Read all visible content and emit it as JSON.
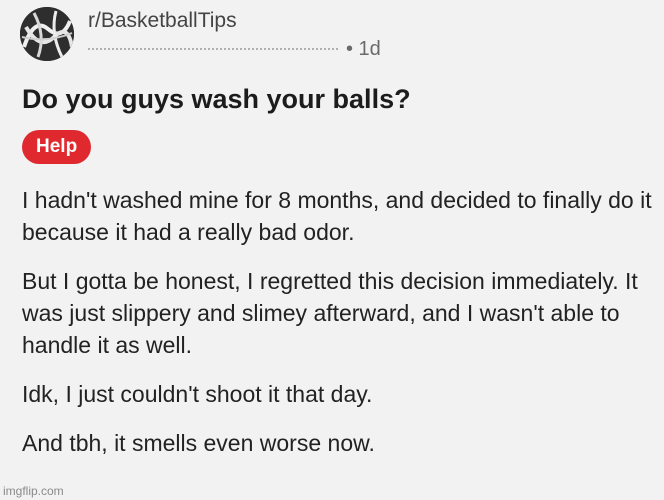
{
  "post": {
    "subreddit": "r/BasketballTips",
    "time_ago": "• 1d",
    "title": "Do you guys wash your balls?",
    "flair": {
      "label": "Help",
      "color": "#e0282f"
    },
    "paragraphs": [
      "I hadn't washed mine for 8 months, and decided to finally do it because it had a really bad odor.",
      "But I gotta be honest, I regretted this decision immediately. It was just slippery and slimey afterward, and I wasn't able to handle it as well.",
      "Idk, I just couldn't shoot it that day.",
      "And tbh, it smells even worse now."
    ]
  },
  "watermark": "imgflip.com",
  "icons": {
    "avatar": "community-avatar"
  }
}
